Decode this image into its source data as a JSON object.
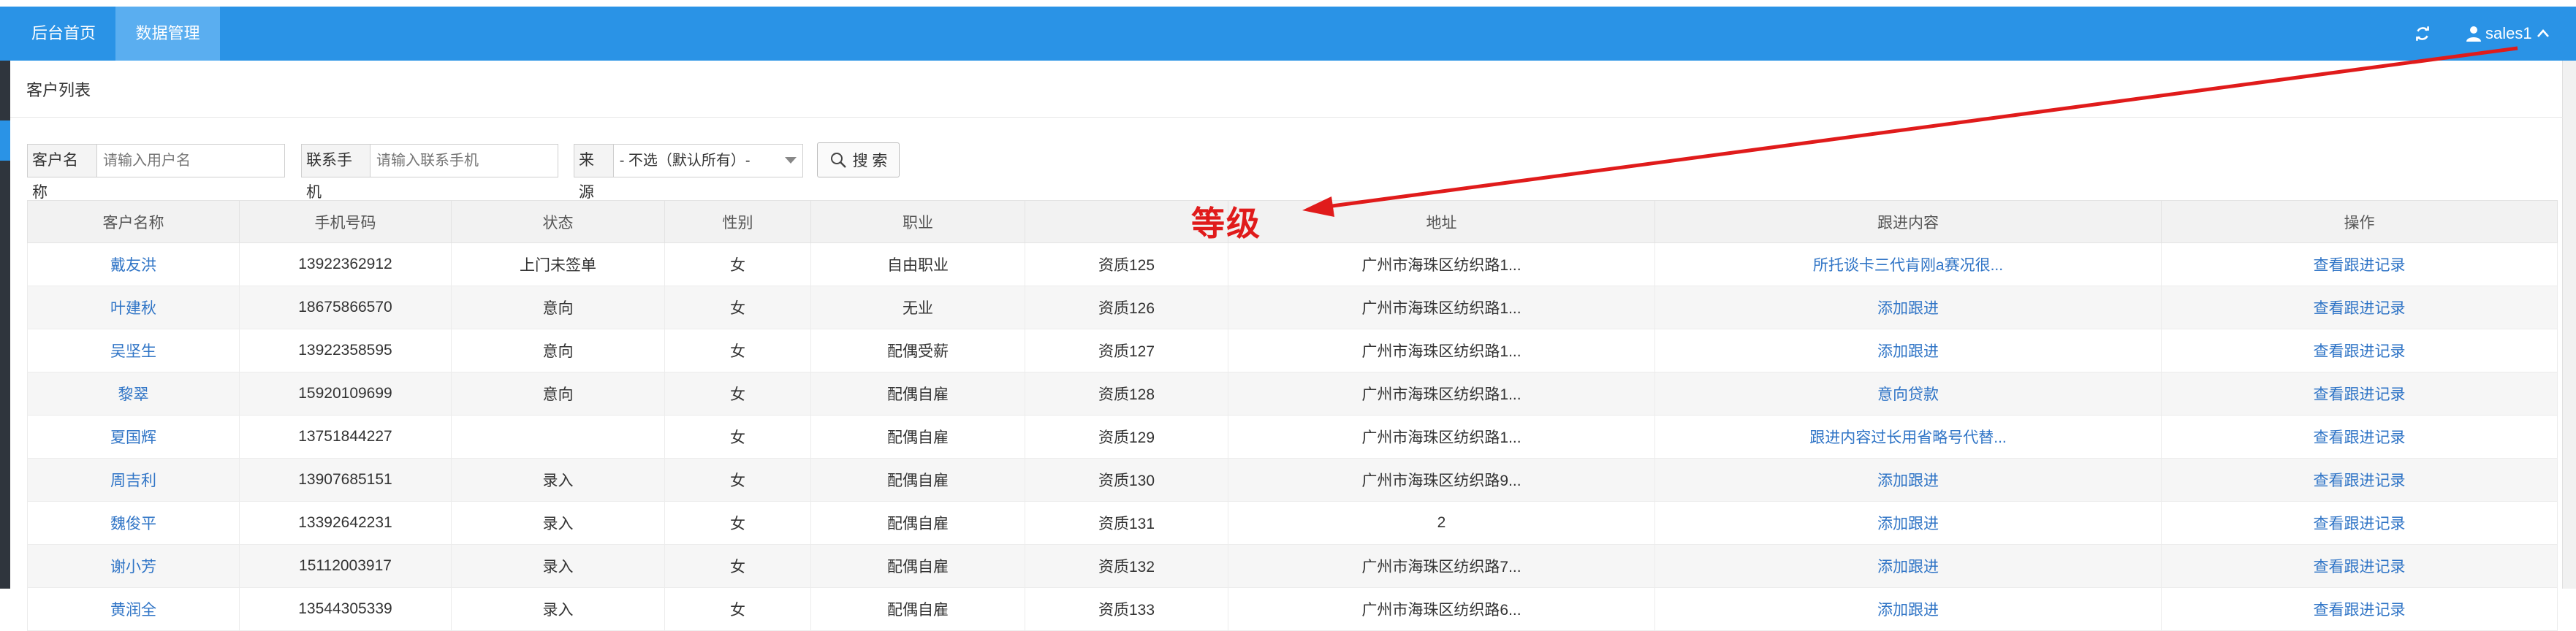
{
  "topbar": {
    "tabs": [
      {
        "label": "后台首页"
      },
      {
        "label": "数据管理"
      }
    ],
    "user": {
      "name": "sales1"
    },
    "icons": {
      "refresh": "refresh-icon",
      "user": "user-icon",
      "chevron": "chevron-up-icon"
    }
  },
  "page": {
    "title": "客户列表"
  },
  "filters": {
    "customer_name": {
      "label": "客户名称",
      "placeholder": "请输入用户名"
    },
    "phone": {
      "label": "联系手机",
      "placeholder": "请输入联系手机"
    },
    "source": {
      "label": "来源",
      "selected": "- 不选（默认所有）-"
    },
    "search_label": "搜 索"
  },
  "table": {
    "headers": [
      "客户名称",
      "手机号码",
      "状态",
      "性别",
      "职业",
      "等级",
      "地址",
      "跟进内容",
      "操作"
    ],
    "rows": [
      {
        "name": "戴友洪",
        "phone": "13922362912",
        "status": "上门未签单",
        "gender": "女",
        "job": "自由职业",
        "level": "资质125",
        "address": "广州市海珠区纺织路1...",
        "follow": "所托谈卡三代肯刚a赛况很...",
        "action": "查看跟进记录"
      },
      {
        "name": "叶建秋",
        "phone": "18675866570",
        "status": "意向",
        "gender": "女",
        "job": "无业",
        "level": "资质126",
        "address": "广州市海珠区纺织路1...",
        "follow": "添加跟进",
        "action": "查看跟进记录"
      },
      {
        "name": "吴坚生",
        "phone": "13922358595",
        "status": "意向",
        "gender": "女",
        "job": "配偶受薪",
        "level": "资质127",
        "address": "广州市海珠区纺织路1...",
        "follow": "添加跟进",
        "action": "查看跟进记录"
      },
      {
        "name": "黎翠",
        "phone": "15920109699",
        "status": "意向",
        "gender": "女",
        "job": "配偶自雇",
        "level": "资质128",
        "address": "广州市海珠区纺织路1...",
        "follow": "意向贷款",
        "action": "查看跟进记录"
      },
      {
        "name": "夏国辉",
        "phone": "13751844227",
        "status": "",
        "gender": "女",
        "job": "配偶自雇",
        "level": "资质129",
        "address": "广州市海珠区纺织路1...",
        "follow": "跟进内容过长用省略号代替...",
        "action": "查看跟进记录"
      },
      {
        "name": "周吉利",
        "phone": "13907685151",
        "status": "录入",
        "gender": "女",
        "job": "配偶自雇",
        "level": "资质130",
        "address": "广州市海珠区纺织路9...",
        "follow": "添加跟进",
        "action": "查看跟进记录"
      },
      {
        "name": "魏俊平",
        "phone": "13392642231",
        "status": "录入",
        "gender": "女",
        "job": "配偶自雇",
        "level": "资质131",
        "address": "2",
        "follow": "添加跟进",
        "action": "查看跟进记录"
      },
      {
        "name": "谢小芳",
        "phone": "15112003917",
        "status": "录入",
        "gender": "女",
        "job": "配偶自雇",
        "level": "资质132",
        "address": "广州市海珠区纺织路7...",
        "follow": "添加跟进",
        "action": "查看跟进记录"
      },
      {
        "name": "黄润全",
        "phone": "13544305339",
        "status": "录入",
        "gender": "女",
        "job": "配偶自雇",
        "level": "资质133",
        "address": "广州市海珠区纺织路6...",
        "follow": "添加跟进",
        "action": "查看跟进记录"
      }
    ]
  },
  "annotation": {
    "text": "等级",
    "color": "#e01b1b"
  },
  "colors": {
    "accent": "#2a93e6",
    "link": "#2f74c6"
  }
}
